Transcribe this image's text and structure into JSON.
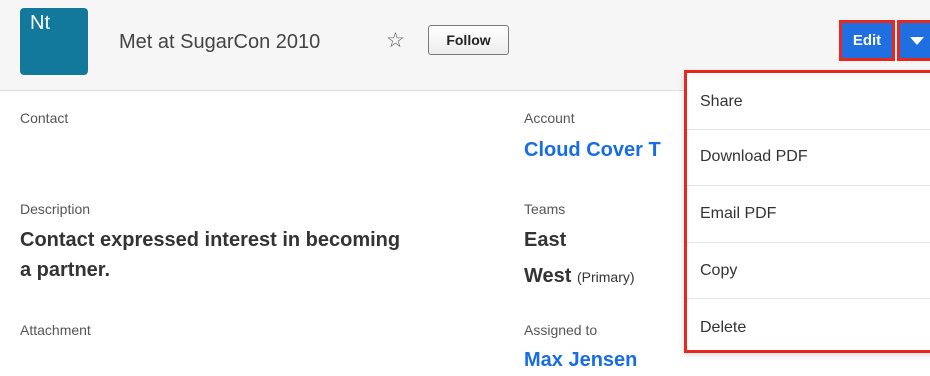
{
  "colors": {
    "module": "#13799c",
    "primary": "#1f6fe0",
    "highlight": "#e8281e",
    "link": "#176de5"
  },
  "header": {
    "module_abbr": "Nt",
    "title": "Met at SugarCon 2010",
    "star_icon": "star-outline-icon",
    "follow_label": "Follow",
    "edit_label": "Edit",
    "caret_icon": "caret-down-icon"
  },
  "fields": {
    "contact": {
      "label": "Contact",
      "value": ""
    },
    "account": {
      "label": "Account",
      "value": "Cloud Cover T"
    },
    "description": {
      "label": "Description",
      "line1": "Contact expressed interest in becoming",
      "line2": "a partner."
    },
    "teams": {
      "label": "Teams",
      "team1": "East",
      "team2": "West",
      "team2_tag": "(Primary)"
    },
    "attachment": {
      "label": "Attachment",
      "value": ""
    },
    "assigned_to": {
      "label": "Assigned to",
      "value": "Max Jensen"
    }
  },
  "menu": {
    "items": [
      {
        "label": "Share"
      },
      {
        "label": "Download PDF"
      },
      {
        "label": "Email PDF"
      },
      {
        "label": "Copy"
      },
      {
        "label": "Delete"
      }
    ]
  }
}
